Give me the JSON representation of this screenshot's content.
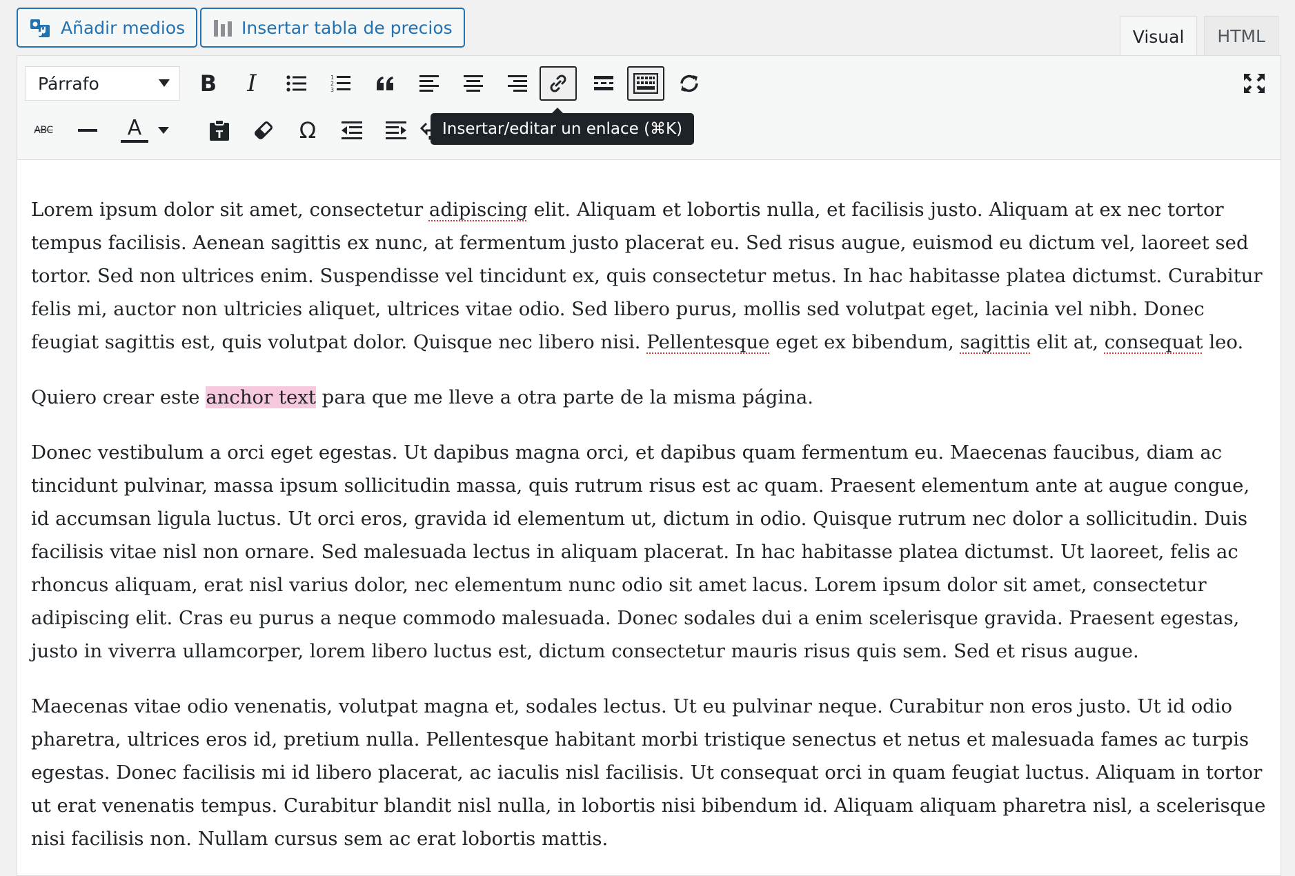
{
  "header": {
    "add_media_label": "Añadir medios",
    "insert_pricing_table_label": "Insertar tabla de precios",
    "tabs": [
      {
        "label": "Visual",
        "active": true
      },
      {
        "label": "HTML",
        "active": false
      }
    ]
  },
  "toolbar": {
    "format_select": "Párrafo",
    "tooltip": "Insertar/editar un enlace (⌘K)",
    "italic_glyph": "I",
    "bold_glyph": "B",
    "text_color_glyph": "A",
    "special_char_glyph": "Ω",
    "strike_glyph": "ABC",
    "icons_row1": [
      "bold-icon",
      "italic-icon",
      "bullet-list-icon",
      "numbered-list-icon",
      "blockquote-icon",
      "align-left-icon",
      "align-center-icon",
      "align-right-icon",
      "link-icon",
      "read-more-icon",
      "toolbar-toggle-icon",
      "refresh-icon",
      "fullscreen-icon"
    ],
    "icons_row2": [
      "strikethrough-icon",
      "horizontal-line-icon",
      "text-color-icon",
      "paste-text-icon",
      "clear-format-icon",
      "special-char-icon",
      "outdent-icon",
      "indent-icon",
      "undo-icon"
    ]
  },
  "content": {
    "p1_a": "Lorem ipsum dolor sit amet, consectetur ",
    "p1_w1": "adipiscing",
    "p1_b": " elit. Aliquam et lobortis nulla, et facilisis justo. Aliquam at ex nec tortor tempus facilisis. Aenean sagittis ex nunc, at fermentum justo placerat eu. Sed risus augue, euismod eu dictum vel, laoreet sed tortor. Sed non ultrices enim. Suspendisse vel tincidunt ex, quis consectetur metus. In hac habitasse platea dictumst. Curabitur felis mi, auctor non ultricies aliquet, ultrices vitae odio. Sed libero purus, mollis sed volutpat eget, lacinia vel nibh. Donec feugiat sagittis est, quis volutpat dolor. Quisque nec libero nisi. ",
    "p1_w2": "Pellentesque",
    "p1_c": " eget ex bibendum, ",
    "p1_w3": "sagittis",
    "p1_d": " elit at, ",
    "p1_w4": "consequat",
    "p1_e": " leo.",
    "p2_a": "Quiero crear este ",
    "p2_anchor": "anchor text",
    "p2_b": " para que me lleve a otra parte de la misma página.",
    "p3": "Donec vestibulum a orci eget egestas. Ut dapibus magna orci, et dapibus quam fermentum eu. Maecenas faucibus, diam ac tincidunt pulvinar, massa ipsum sollicitudin massa, quis rutrum risus est ac quam. Praesent elementum ante at augue congue, id accumsan ligula luctus. Ut orci eros, gravida id elementum ut, dictum in odio. Quisque rutrum nec dolor a sollicitudin. Duis facilisis vitae nisl non ornare. Sed malesuada lectus in aliquam placerat. In hac habitasse platea dictumst. Ut laoreet, felis ac rhoncus aliquam, erat nisl varius dolor, nec elementum nunc odio sit amet lacus. Lorem ipsum dolor sit amet, consectetur adipiscing elit. Cras eu purus a neque commodo malesuada. Donec sodales dui a enim scelerisque gravida. Praesent egestas, justo in viverra ullamcorper, lorem libero luctus est, dictum consectetur mauris risus quis sem. Sed et risus augue.",
    "p4": "Maecenas vitae odio venenatis, volutpat magna et, sodales lectus. Ut eu pulvinar neque. Curabitur non eros justo. Ut id odio pharetra, ultrices eros id, pretium nulla. Pellentesque habitant morbi tristique senectus et netus et malesuada fames ac turpis egestas. Donec facilisis mi id libero placerat, ac iaculis nisl facilisis. Ut consequat orci in quam feugiat luctus. Aliquam in tortor ut erat venenatis tempus. Curabitur blandit nisl nulla, in lobortis nisi bibendum id. Aliquam aliquam pharetra nisl, a scelerisque nisi facilisis non. Nullam cursus sem ac erat lobortis mattis."
  },
  "colors": {
    "accent": "#2271b1",
    "anchor_highlight": "#f7c9dd",
    "spell_underline": "#d63638",
    "tooltip_bg": "#1d2327"
  }
}
